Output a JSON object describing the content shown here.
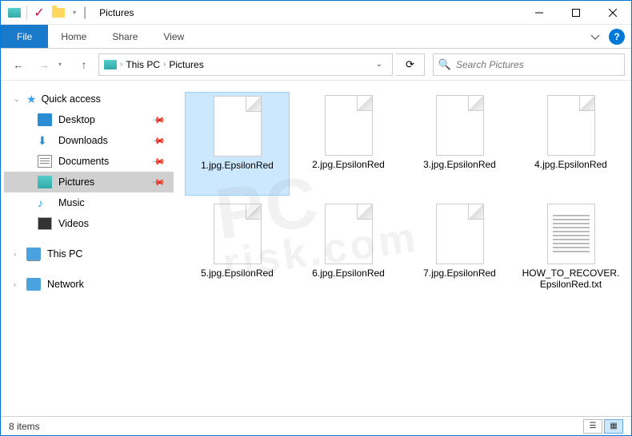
{
  "window": {
    "title": "Pictures"
  },
  "ribbon": {
    "file": "File",
    "tabs": [
      "Home",
      "Share",
      "View"
    ]
  },
  "breadcrumb": {
    "items": [
      "This PC",
      "Pictures"
    ]
  },
  "search": {
    "placeholder": "Search Pictures"
  },
  "sidebar": {
    "quick_access": "Quick access",
    "items": [
      {
        "label": "Desktop",
        "pinned": true
      },
      {
        "label": "Downloads",
        "pinned": true
      },
      {
        "label": "Documents",
        "pinned": true
      },
      {
        "label": "Pictures",
        "pinned": true,
        "selected": true
      },
      {
        "label": "Music",
        "pinned": false
      },
      {
        "label": "Videos",
        "pinned": false
      }
    ],
    "this_pc": "This PC",
    "network": "Network"
  },
  "files": [
    {
      "name": "1.jpg.EpsilonRed",
      "type": "blank",
      "selected": true
    },
    {
      "name": "2.jpg.EpsilonRed",
      "type": "blank"
    },
    {
      "name": "3.jpg.EpsilonRed",
      "type": "blank"
    },
    {
      "name": "4.jpg.EpsilonRed",
      "type": "blank"
    },
    {
      "name": "5.jpg.EpsilonRed",
      "type": "blank"
    },
    {
      "name": "6.jpg.EpsilonRed",
      "type": "blank"
    },
    {
      "name": "7.jpg.EpsilonRed",
      "type": "blank"
    },
    {
      "name": "HOW_TO_RECOVER.EpsilonRed.txt",
      "type": "txt"
    }
  ],
  "status": {
    "count": "8 items"
  },
  "watermark": {
    "l1": "PC",
    "l2": "risk.com"
  }
}
